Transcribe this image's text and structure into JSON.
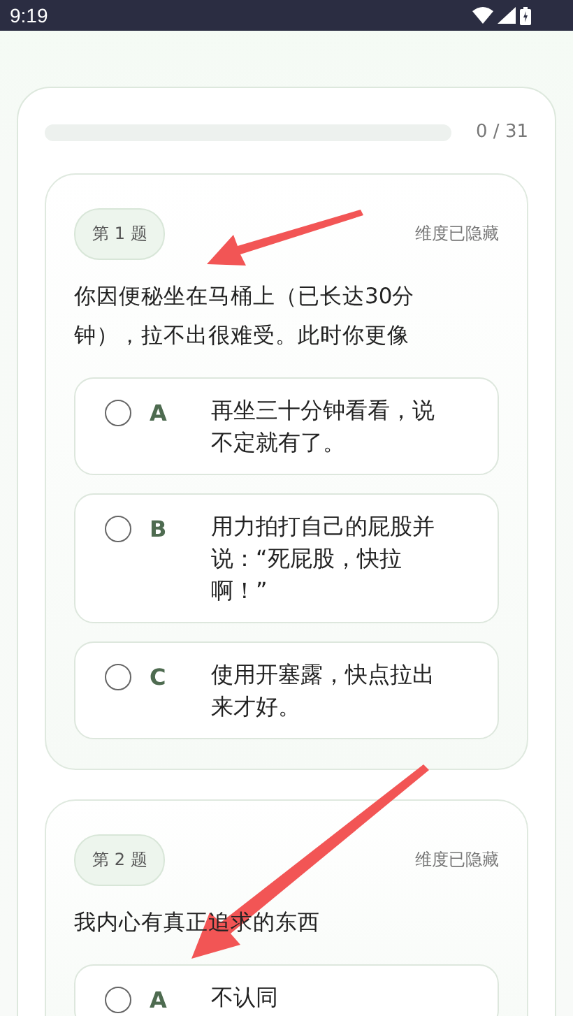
{
  "status_bar": {
    "time": "9:19"
  },
  "progress": {
    "level": 0,
    "count": "0 / 31"
  },
  "questions": [
    {
      "tag": "第 1 题",
      "note": "维度已隐藏",
      "text": "你因便秘坐在马桶上（已长达30分钟），拉不出很难受。此时你更像",
      "options": [
        {
          "letter": "A",
          "text": "再坐三十分钟看看，说不定就有了。",
          "selected": false
        },
        {
          "letter": "B",
          "text": "用力拍打自己的屁股并说：“死屁股，快拉啊！”",
          "selected": false
        },
        {
          "letter": "C",
          "text": "使用开塞露，快点拉出来才好。",
          "selected": false
        }
      ]
    },
    {
      "tag": "第 2 题",
      "note": "维度已隐藏",
      "text": "我内心有真正追求的东西",
      "options": [
        {
          "letter": "A",
          "text": "不认同",
          "selected": false
        }
      ]
    }
  ]
}
